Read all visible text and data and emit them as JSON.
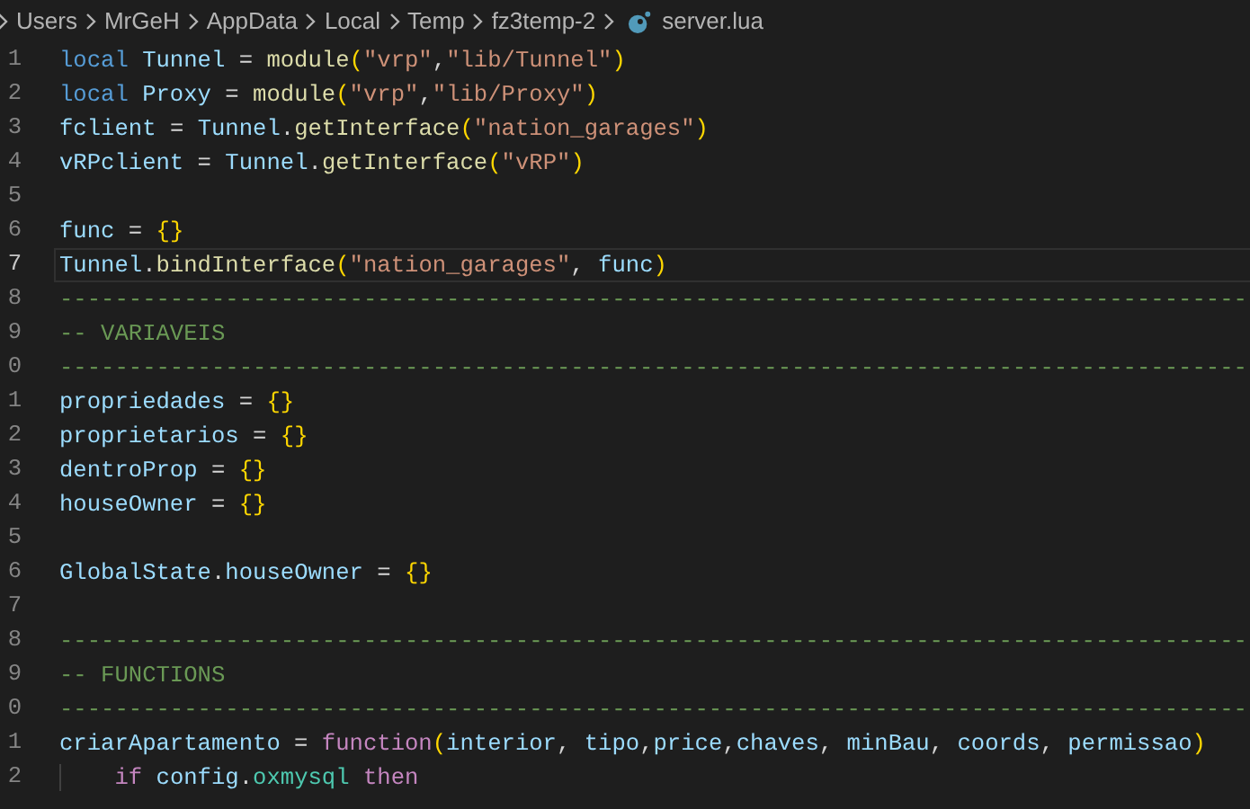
{
  "breadcrumb": {
    "segments": [
      "Users",
      "MrGeH",
      "AppData",
      "Local",
      "Temp",
      "fz3temp-2"
    ],
    "file": "server.lua"
  },
  "editor": {
    "lines": [
      {
        "number": "1",
        "current": false,
        "tokens": [
          {
            "kind": "storage",
            "text": "local "
          },
          {
            "kind": "variable",
            "text": "Tunnel"
          },
          {
            "kind": "plain",
            "text": " = "
          },
          {
            "kind": "function",
            "text": "module"
          },
          {
            "kind": "bracket",
            "text": "("
          },
          {
            "kind": "string",
            "text": "\"vrp\""
          },
          {
            "kind": "plain",
            "text": ","
          },
          {
            "kind": "string",
            "text": "\"lib/Tunnel\""
          },
          {
            "kind": "bracket",
            "text": ")"
          }
        ]
      },
      {
        "number": "2",
        "current": false,
        "tokens": [
          {
            "kind": "storage",
            "text": "local "
          },
          {
            "kind": "variable",
            "text": "Proxy"
          },
          {
            "kind": "plain",
            "text": " = "
          },
          {
            "kind": "function",
            "text": "module"
          },
          {
            "kind": "bracket",
            "text": "("
          },
          {
            "kind": "string",
            "text": "\"vrp\""
          },
          {
            "kind": "plain",
            "text": ","
          },
          {
            "kind": "string",
            "text": "\"lib/Proxy\""
          },
          {
            "kind": "bracket",
            "text": ")"
          }
        ]
      },
      {
        "number": "3",
        "current": false,
        "tokens": [
          {
            "kind": "variable",
            "text": "fclient"
          },
          {
            "kind": "plain",
            "text": " = "
          },
          {
            "kind": "variable",
            "text": "Tunnel"
          },
          {
            "kind": "plain",
            "text": "."
          },
          {
            "kind": "function",
            "text": "getInterface"
          },
          {
            "kind": "bracket",
            "text": "("
          },
          {
            "kind": "string",
            "text": "\"nation_garages\""
          },
          {
            "kind": "bracket",
            "text": ")"
          }
        ]
      },
      {
        "number": "4",
        "current": false,
        "tokens": [
          {
            "kind": "variable",
            "text": "vRPclient"
          },
          {
            "kind": "plain",
            "text": " = "
          },
          {
            "kind": "variable",
            "text": "Tunnel"
          },
          {
            "kind": "plain",
            "text": "."
          },
          {
            "kind": "function",
            "text": "getInterface"
          },
          {
            "kind": "bracket",
            "text": "("
          },
          {
            "kind": "string",
            "text": "\"vRP\""
          },
          {
            "kind": "bracket",
            "text": ")"
          }
        ]
      },
      {
        "number": "5",
        "current": false
      },
      {
        "number": "6",
        "current": false,
        "tokens": [
          {
            "kind": "variable",
            "text": "func"
          },
          {
            "kind": "plain",
            "text": " = "
          },
          {
            "kind": "bracket",
            "text": "{}"
          }
        ]
      },
      {
        "number": "7",
        "current": true,
        "tokens": [
          {
            "kind": "variable",
            "text": "Tunnel"
          },
          {
            "kind": "plain",
            "text": "."
          },
          {
            "kind": "function",
            "text": "bindInterface"
          },
          {
            "kind": "bracket",
            "text": "("
          },
          {
            "kind": "string",
            "text": "\"nation_garages\""
          },
          {
            "kind": "plain",
            "text": ", "
          },
          {
            "kind": "variable",
            "text": "func"
          },
          {
            "kind": "bracket",
            "text": ")"
          }
        ]
      },
      {
        "number": "8",
        "current": false,
        "tokens": [
          {
            "kind": "comment",
            "text": "--------------------------------------------------------------------------------------"
          }
        ]
      },
      {
        "number": "9",
        "current": false,
        "tokens": [
          {
            "kind": "comment",
            "text": "-- VARIAVEIS"
          }
        ]
      },
      {
        "number": "0",
        "current": false,
        "tokens": [
          {
            "kind": "comment",
            "text": "--------------------------------------------------------------------------------------"
          }
        ]
      },
      {
        "number": "1",
        "current": false,
        "tokens": [
          {
            "kind": "variable",
            "text": "propriedades"
          },
          {
            "kind": "plain",
            "text": " = "
          },
          {
            "kind": "bracket",
            "text": "{}"
          }
        ]
      },
      {
        "number": "2",
        "current": false,
        "tokens": [
          {
            "kind": "variable",
            "text": "proprietarios"
          },
          {
            "kind": "plain",
            "text": " = "
          },
          {
            "kind": "bracket",
            "text": "{}"
          }
        ]
      },
      {
        "number": "3",
        "current": false,
        "tokens": [
          {
            "kind": "variable",
            "text": "dentroProp"
          },
          {
            "kind": "plain",
            "text": " = "
          },
          {
            "kind": "bracket",
            "text": "{}"
          }
        ]
      },
      {
        "number": "4",
        "current": false,
        "tokens": [
          {
            "kind": "variable",
            "text": "houseOwner"
          },
          {
            "kind": "plain",
            "text": " = "
          },
          {
            "kind": "bracket",
            "text": "{}"
          }
        ]
      },
      {
        "number": "5",
        "current": false
      },
      {
        "number": "6",
        "current": false,
        "tokens": [
          {
            "kind": "variable",
            "text": "GlobalState"
          },
          {
            "kind": "plain",
            "text": "."
          },
          {
            "kind": "variable",
            "text": "houseOwner"
          },
          {
            "kind": "plain",
            "text": " = "
          },
          {
            "kind": "bracket",
            "text": "{}"
          }
        ]
      },
      {
        "number": "7",
        "current": false
      },
      {
        "number": "8",
        "current": false,
        "tokens": [
          {
            "kind": "comment",
            "text": "--------------------------------------------------------------------------------------"
          }
        ]
      },
      {
        "number": "9",
        "current": false,
        "tokens": [
          {
            "kind": "comment",
            "text": "-- FUNCTIONS"
          }
        ]
      },
      {
        "number": "0",
        "current": false,
        "tokens": [
          {
            "kind": "comment",
            "text": "--------------------------------------------------------------------------------------"
          }
        ]
      },
      {
        "number": "1",
        "current": false,
        "tokens": [
          {
            "kind": "variable",
            "text": "criarApartamento"
          },
          {
            "kind": "plain",
            "text": " = "
          },
          {
            "kind": "keyword",
            "text": "function"
          },
          {
            "kind": "bracket",
            "text": "("
          },
          {
            "kind": "variable",
            "text": "interior"
          },
          {
            "kind": "plain",
            "text": ", "
          },
          {
            "kind": "variable",
            "text": "tipo"
          },
          {
            "kind": "plain",
            "text": ","
          },
          {
            "kind": "variable",
            "text": "price"
          },
          {
            "kind": "plain",
            "text": ","
          },
          {
            "kind": "variable",
            "text": "chaves"
          },
          {
            "kind": "plain",
            "text": ", "
          },
          {
            "kind": "variable",
            "text": "minBau"
          },
          {
            "kind": "plain",
            "text": ", "
          },
          {
            "kind": "variable",
            "text": "coords"
          },
          {
            "kind": "plain",
            "text": ", "
          },
          {
            "kind": "variable",
            "text": "permissao"
          },
          {
            "kind": "bracket",
            "text": ")"
          }
        ]
      },
      {
        "number": "2",
        "current": false,
        "indented": true,
        "tokens": [
          {
            "kind": "keyword",
            "text": "if "
          },
          {
            "kind": "variable",
            "text": "config"
          },
          {
            "kind": "plain",
            "text": "."
          },
          {
            "kind": "property",
            "text": "oxmysql"
          },
          {
            "kind": "keyword",
            "text": " then"
          }
        ]
      }
    ]
  }
}
